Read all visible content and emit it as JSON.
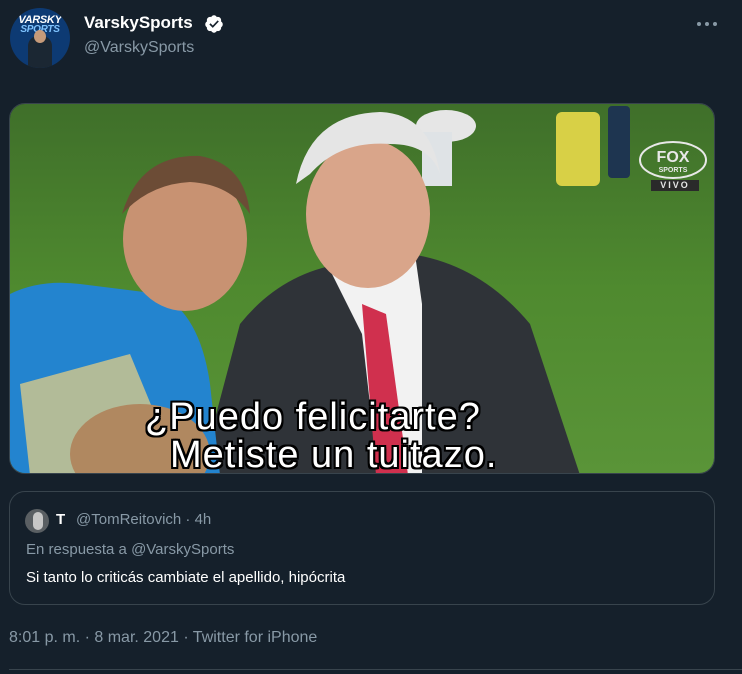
{
  "author": {
    "display_name": "VarskySports",
    "handle": "@VarskySports",
    "verified": true,
    "avatar_text_top": "VARSKY",
    "avatar_text_bottom": "SPORTS"
  },
  "media": {
    "caption_line1": "¿Puedo felicitarte?",
    "caption_line2": "Metiste un tuitazo.",
    "channel_logo_top": "FOX",
    "channel_logo_bottom": "SPORTS",
    "channel_tag": "VIVO"
  },
  "quoted_tweet": {
    "name": "T",
    "handle_time": "@TomReitovich · 4h",
    "reply_context": "En respuesta a @VarskySports",
    "text": "Si tanto lo criticás cambiate el apellido, hipócrita"
  },
  "footer": {
    "timestamp": "8:01 p. m. · 8 mar. 2021 · Twitter for iPhone"
  },
  "colors": {
    "background": "#15202b",
    "secondary_text": "#8899a6",
    "border": "#38444d",
    "verified": "#ffffff"
  },
  "icons": [
    "verified-badge-icon",
    "more-options-icon"
  ]
}
